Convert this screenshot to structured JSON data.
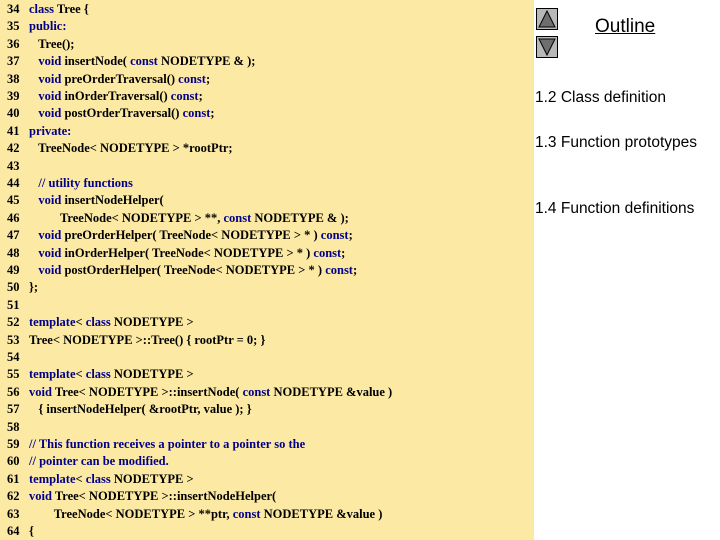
{
  "outline": {
    "title": "Outline",
    "items": [
      "1.2 Class definition",
      "1.3 Function prototypes",
      "1.4 Function definitions"
    ]
  },
  "code_lines": [
    {
      "n": "34",
      "parts": [
        {
          "t": "class",
          "k": "kw"
        },
        {
          "t": " Tree {"
        }
      ]
    },
    {
      "n": "35",
      "parts": [
        {
          "t": "public:",
          "k": "kw"
        }
      ]
    },
    {
      "n": "36",
      "parts": [
        {
          "t": "   Tree();"
        }
      ]
    },
    {
      "n": "37",
      "parts": [
        {
          "t": "   "
        },
        {
          "t": "void",
          "k": "kw"
        },
        {
          "t": " insertNode( "
        },
        {
          "t": "const",
          "k": "kw"
        },
        {
          "t": " NODETYPE & );"
        }
      ]
    },
    {
      "n": "38",
      "parts": [
        {
          "t": "   "
        },
        {
          "t": "void",
          "k": "kw"
        },
        {
          "t": " preOrderTraversal() "
        },
        {
          "t": "const",
          "k": "kw"
        },
        {
          "t": ";"
        }
      ]
    },
    {
      "n": "39",
      "parts": [
        {
          "t": "   "
        },
        {
          "t": "void",
          "k": "kw"
        },
        {
          "t": " inOrderTraversal() "
        },
        {
          "t": "const",
          "k": "kw"
        },
        {
          "t": ";"
        }
      ]
    },
    {
      "n": "40",
      "parts": [
        {
          "t": "   "
        },
        {
          "t": "void",
          "k": "kw"
        },
        {
          "t": " postOrderTraversal() "
        },
        {
          "t": "const",
          "k": "kw"
        },
        {
          "t": ";"
        }
      ]
    },
    {
      "n": "41",
      "parts": [
        {
          "t": "private:",
          "k": "kw"
        }
      ]
    },
    {
      "n": "42",
      "parts": [
        {
          "t": "   TreeNode< NODETYPE > *rootPtr;"
        }
      ]
    },
    {
      "n": "43",
      "parts": []
    },
    {
      "n": "44",
      "parts": [
        {
          "t": "   "
        },
        {
          "t": "// utility functions",
          "k": "cm"
        }
      ]
    },
    {
      "n": "45",
      "parts": [
        {
          "t": "   "
        },
        {
          "t": "void",
          "k": "kw"
        },
        {
          "t": " insertNodeHelper("
        }
      ]
    },
    {
      "n": "46",
      "parts": [
        {
          "t": "          TreeNode< NODETYPE > **, "
        },
        {
          "t": "const",
          "k": "kw"
        },
        {
          "t": " NODETYPE & );"
        }
      ]
    },
    {
      "n": "47",
      "parts": [
        {
          "t": "   "
        },
        {
          "t": "void",
          "k": "kw"
        },
        {
          "t": " preOrderHelper( TreeNode< NODETYPE > * ) "
        },
        {
          "t": "const",
          "k": "kw"
        },
        {
          "t": ";"
        }
      ]
    },
    {
      "n": "48",
      "parts": [
        {
          "t": "   "
        },
        {
          "t": "void",
          "k": "kw"
        },
        {
          "t": " inOrderHelper( TreeNode< NODETYPE > * ) "
        },
        {
          "t": "const",
          "k": "kw"
        },
        {
          "t": ";"
        }
      ]
    },
    {
      "n": "49",
      "parts": [
        {
          "t": "   "
        },
        {
          "t": "void",
          "k": "kw"
        },
        {
          "t": " postOrderHelper( TreeNode< NODETYPE > * ) "
        },
        {
          "t": "const",
          "k": "kw"
        },
        {
          "t": ";"
        }
      ]
    },
    {
      "n": "50",
      "parts": [
        {
          "t": "};"
        }
      ]
    },
    {
      "n": "51",
      "parts": []
    },
    {
      "n": "52",
      "parts": [
        {
          "t": "template",
          "k": "kw"
        },
        {
          "t": "< "
        },
        {
          "t": "class",
          "k": "kw"
        },
        {
          "t": " NODETYPE >"
        }
      ]
    },
    {
      "n": "53",
      "parts": [
        {
          "t": "Tree< NODETYPE >::Tree() { rootPtr = 0; }"
        }
      ]
    },
    {
      "n": "54",
      "parts": []
    },
    {
      "n": "55",
      "parts": [
        {
          "t": "template",
          "k": "kw"
        },
        {
          "t": "< "
        },
        {
          "t": "class",
          "k": "kw"
        },
        {
          "t": " NODETYPE >"
        }
      ]
    },
    {
      "n": "56",
      "parts": [
        {
          "t": "void",
          "k": "kw"
        },
        {
          "t": " Tree< NODETYPE >::insertNode( "
        },
        {
          "t": "const",
          "k": "kw"
        },
        {
          "t": " NODETYPE &value )"
        }
      ]
    },
    {
      "n": "57",
      "parts": [
        {
          "t": "   { insertNodeHelper( &rootPtr, value ); }"
        }
      ]
    },
    {
      "n": "58",
      "parts": []
    },
    {
      "n": "59",
      "parts": [
        {
          "t": "// This function receives a pointer to a pointer so the",
          "k": "cm"
        }
      ]
    },
    {
      "n": "60",
      "parts": [
        {
          "t": "// pointer can be modified.",
          "k": "cm"
        }
      ]
    },
    {
      "n": "61",
      "parts": [
        {
          "t": "template",
          "k": "kw"
        },
        {
          "t": "< "
        },
        {
          "t": "class",
          "k": "kw"
        },
        {
          "t": " NODETYPE >"
        }
      ]
    },
    {
      "n": "62",
      "parts": [
        {
          "t": "void",
          "k": "kw"
        },
        {
          "t": " Tree< NODETYPE >::insertNodeHelper("
        }
      ]
    },
    {
      "n": "63",
      "parts": [
        {
          "t": "        TreeNode< NODETYPE > **ptr, "
        },
        {
          "t": "const",
          "k": "kw"
        },
        {
          "t": " NODETYPE &value )"
        }
      ]
    },
    {
      "n": "64",
      "parts": [
        {
          "t": "{"
        }
      ]
    }
  ]
}
